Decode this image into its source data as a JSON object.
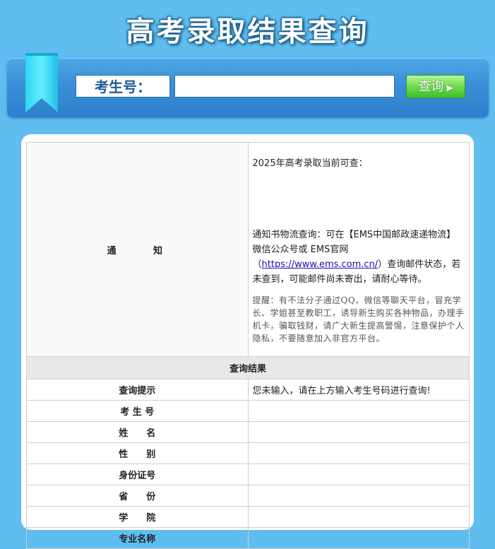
{
  "header": {
    "title": "高考录取结果查询"
  },
  "search": {
    "label": "考生号：",
    "input_value": "",
    "button_label": "查询"
  },
  "notice": {
    "label": "通 知",
    "headline": "2025年高考录取当前可查：",
    "logistics_prefix": "通知书物流查询：可在【EMS中国邮政速递物流】微信公众号或 EMS官网（",
    "link_text": "https://www.ems.com.cn/",
    "logistics_suffix": "）查询邮件状态，若未查到，可能邮件尚未寄出，请耐心等待。",
    "warning": "提醒：有不法分子通过QQ、微信等聊天平台，冒充学长、学姐甚至教职工，诱导新生购买各种物品，办理手机卡，骗取钱财，请广大新生提高警惕，注意保护个人隐私，不要随意加入非官方平台。"
  },
  "results": {
    "section_title": "查询结果",
    "hint_label": "查询提示",
    "hint_value": "您未输入，请在上方输入考生号码进行查询!",
    "rows": [
      {
        "label": "考 生 号",
        "value": ""
      },
      {
        "label": "姓　　名",
        "value": ""
      },
      {
        "label": "性　　别",
        "value": ""
      },
      {
        "label": "身份证号",
        "value": ""
      },
      {
        "label": "省　　份",
        "value": ""
      },
      {
        "label": "学　　院",
        "value": ""
      },
      {
        "label": "专业名称",
        "value": ""
      }
    ]
  },
  "colors": {
    "background": "#5fbdf0",
    "bar": "#3a8fd6",
    "button": "#6fdb4e",
    "accent_text": "#8a3b00"
  }
}
